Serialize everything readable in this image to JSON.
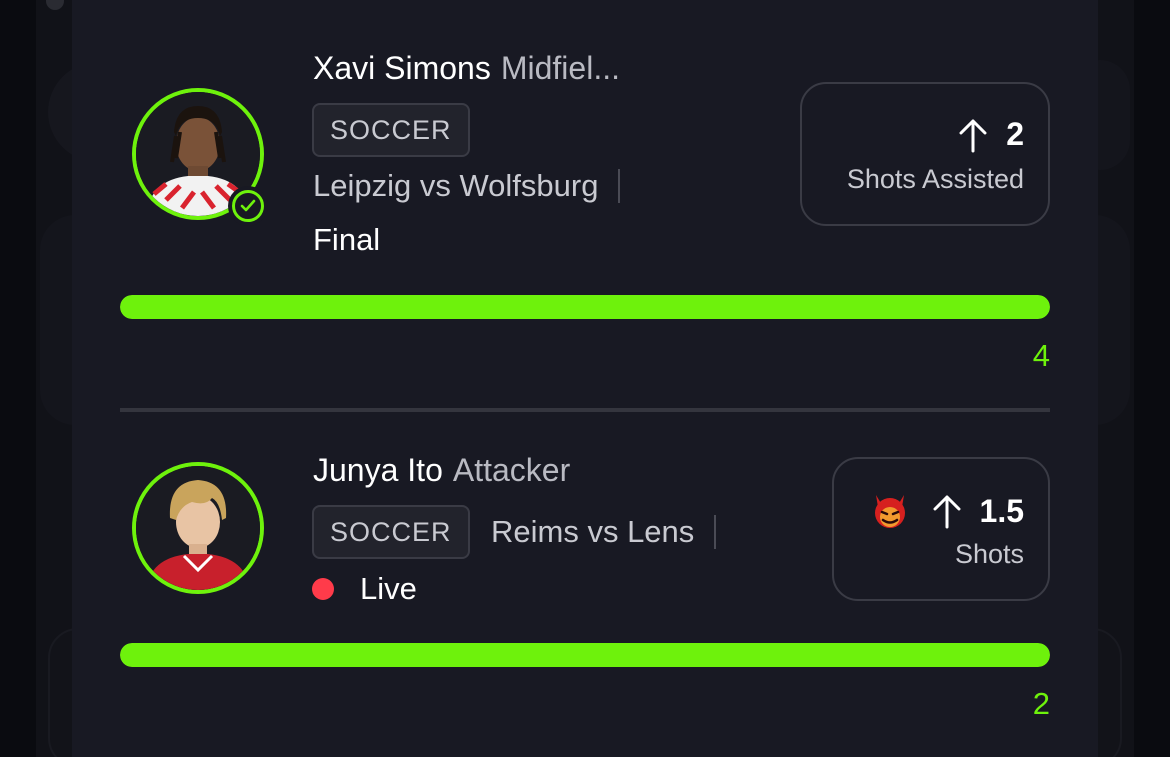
{
  "colors": {
    "accent": "#6ef20c",
    "live": "#ff3b4a",
    "panel": "#181923"
  },
  "picks": [
    {
      "player_name": "Xavi Simons",
      "position": "Midfiel...",
      "sport": "SOCCER",
      "matchup": "Leipzig vs Wolfsburg",
      "status": "Final",
      "status_type": "final",
      "direction_icon": "arrow-up-icon",
      "line": "2",
      "stat_label": "Shots Assisted",
      "actual": "4",
      "progress": 1.0,
      "verified": true
    },
    {
      "player_name": "Junya Ito",
      "position": "Attacker",
      "sport": "SOCCER",
      "matchup": "Reims vs Lens",
      "status": "Live",
      "status_type": "live",
      "direction_icon": "arrow-up-icon",
      "special_icon": "demon-icon",
      "line": "1.5",
      "stat_label": "Shots",
      "actual": "2",
      "progress": 1.0,
      "verified": false
    }
  ]
}
